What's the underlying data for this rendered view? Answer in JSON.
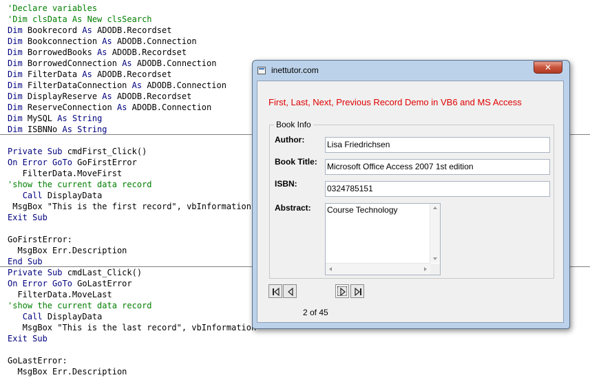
{
  "code_editor": {
    "lines": [
      {
        "segments": [
          {
            "t": "'Declare variables",
            "c": "cm"
          }
        ]
      },
      {
        "segments": [
          {
            "t": "'Dim clsData As New clsSearch",
            "c": "cm"
          }
        ]
      },
      {
        "segments": [
          {
            "t": "Dim",
            "c": "kw"
          },
          {
            "t": " Bookrecord ",
            "c": ""
          },
          {
            "t": "As",
            "c": "kw"
          },
          {
            "t": " ADODB.Recordset",
            "c": ""
          }
        ]
      },
      {
        "segments": [
          {
            "t": "Dim",
            "c": "kw"
          },
          {
            "t": " Bookconnection ",
            "c": ""
          },
          {
            "t": "As",
            "c": "kw"
          },
          {
            "t": " ADODB.Connection",
            "c": ""
          }
        ]
      },
      {
        "segments": [
          {
            "t": "Dim",
            "c": "kw"
          },
          {
            "t": " BorrowedBooks ",
            "c": ""
          },
          {
            "t": "As",
            "c": "kw"
          },
          {
            "t": " ADODB.Recordset",
            "c": ""
          }
        ]
      },
      {
        "segments": [
          {
            "t": "Dim",
            "c": "kw"
          },
          {
            "t": " BorrowedConnection ",
            "c": ""
          },
          {
            "t": "As",
            "c": "kw"
          },
          {
            "t": " ADODB.Connection",
            "c": ""
          }
        ]
      },
      {
        "segments": [
          {
            "t": "Dim",
            "c": "kw"
          },
          {
            "t": " FilterData ",
            "c": ""
          },
          {
            "t": "As",
            "c": "kw"
          },
          {
            "t": " ADODB.Recordset",
            "c": ""
          }
        ]
      },
      {
        "segments": [
          {
            "t": "Dim",
            "c": "kw"
          },
          {
            "t": " FilterDataConnection ",
            "c": ""
          },
          {
            "t": "As",
            "c": "kw"
          },
          {
            "t": " ADODB.Connection",
            "c": ""
          }
        ]
      },
      {
        "segments": [
          {
            "t": "Dim",
            "c": "kw"
          },
          {
            "t": " DisplayReserve ",
            "c": ""
          },
          {
            "t": "As",
            "c": "kw"
          },
          {
            "t": " ADODB.Recordset",
            "c": ""
          }
        ]
      },
      {
        "segments": [
          {
            "t": "Dim",
            "c": "kw"
          },
          {
            "t": " ReserveConnection ",
            "c": ""
          },
          {
            "t": "As",
            "c": "kw"
          },
          {
            "t": " ADODB.Connection",
            "c": ""
          }
        ]
      },
      {
        "segments": [
          {
            "t": "Dim",
            "c": "kw"
          },
          {
            "t": " MySQL ",
            "c": ""
          },
          {
            "t": "As String",
            "c": "kw"
          }
        ]
      },
      {
        "segments": [
          {
            "t": "Dim",
            "c": "kw"
          },
          {
            "t": " ISBNNo ",
            "c": ""
          },
          {
            "t": "As String",
            "c": "kw"
          }
        ]
      },
      {
        "segments": [
          {
            "t": "",
            "c": ""
          }
        ]
      },
      {
        "segments": [
          {
            "t": "Private Sub",
            "c": "kw"
          },
          {
            "t": " cmdFirst_Click()",
            "c": ""
          }
        ]
      },
      {
        "segments": [
          {
            "t": "On Error GoTo",
            "c": "kw"
          },
          {
            "t": " GoFirstError",
            "c": ""
          }
        ]
      },
      {
        "segments": [
          {
            "t": "   FilterData.MoveFirst",
            "c": ""
          }
        ]
      },
      {
        "segments": [
          {
            "t": "'show the current data record",
            "c": "cm"
          }
        ]
      },
      {
        "segments": [
          {
            "t": "   ",
            "c": ""
          },
          {
            "t": "Call",
            "c": "kw"
          },
          {
            "t": " DisplayData",
            "c": ""
          }
        ]
      },
      {
        "segments": [
          {
            "t": " MsgBox \"This is the first record\", vbInformation",
            "c": ""
          }
        ]
      },
      {
        "segments": [
          {
            "t": "Exit Sub",
            "c": "kw"
          }
        ]
      },
      {
        "segments": [
          {
            "t": "",
            "c": ""
          }
        ]
      },
      {
        "segments": [
          {
            "t": "GoFirstError:",
            "c": ""
          }
        ]
      },
      {
        "segments": [
          {
            "t": "  MsgBox Err.Description",
            "c": ""
          }
        ]
      },
      {
        "segments": [
          {
            "t": "End Sub",
            "c": "kw"
          }
        ]
      },
      {
        "segments": [
          {
            "t": "Private Sub",
            "c": "kw"
          },
          {
            "t": " cmdLast_Click()",
            "c": ""
          }
        ]
      },
      {
        "segments": [
          {
            "t": "On Error GoTo",
            "c": "kw"
          },
          {
            "t": " GoLastError",
            "c": ""
          }
        ]
      },
      {
        "segments": [
          {
            "t": "  FilterData.MoveLast",
            "c": ""
          }
        ]
      },
      {
        "segments": [
          {
            "t": "'show the current data record",
            "c": "cm"
          }
        ]
      },
      {
        "segments": [
          {
            "t": "   ",
            "c": ""
          },
          {
            "t": "Call",
            "c": "kw"
          },
          {
            "t": " DisplayData",
            "c": ""
          }
        ]
      },
      {
        "segments": [
          {
            "t": "   MsgBox \"This is the last record\", vbInformation",
            "c": ""
          }
        ]
      },
      {
        "segments": [
          {
            "t": "Exit Sub",
            "c": "kw"
          }
        ]
      },
      {
        "segments": [
          {
            "t": "",
            "c": ""
          }
        ]
      },
      {
        "segments": [
          {
            "t": "GoLastError:",
            "c": ""
          }
        ]
      },
      {
        "segments": [
          {
            "t": "  MsgBox Err.Description",
            "c": ""
          }
        ]
      }
    ]
  },
  "dialog": {
    "title": "inettutor.com",
    "heading": "First, Last, Next, Previous Record Demo in VB6 and MS Access",
    "group_title": "Book Info",
    "fields": {
      "author": {
        "label": "Author:",
        "value": "Lisa Friedrichsen"
      },
      "title": {
        "label": "Book Title:",
        "value": "Microsoft Office Access 2007 1st edition"
      },
      "isbn": {
        "label": "ISBN:",
        "value": "0324785151"
      },
      "abstract": {
        "label": "Abstract:",
        "value": "Course Technology"
      }
    },
    "record_counter": "2  of 45"
  },
  "icons": {
    "first": "first-record-icon",
    "previous": "previous-record-icon",
    "next": "next-record-icon",
    "last": "last-record-icon",
    "close": "close-icon"
  },
  "colors": {
    "keyword": "#00007f",
    "comment": "#007f00",
    "heading_red": "#e00000",
    "dialog_frame": "#bcd2ea",
    "close_button": "#c8523b"
  }
}
